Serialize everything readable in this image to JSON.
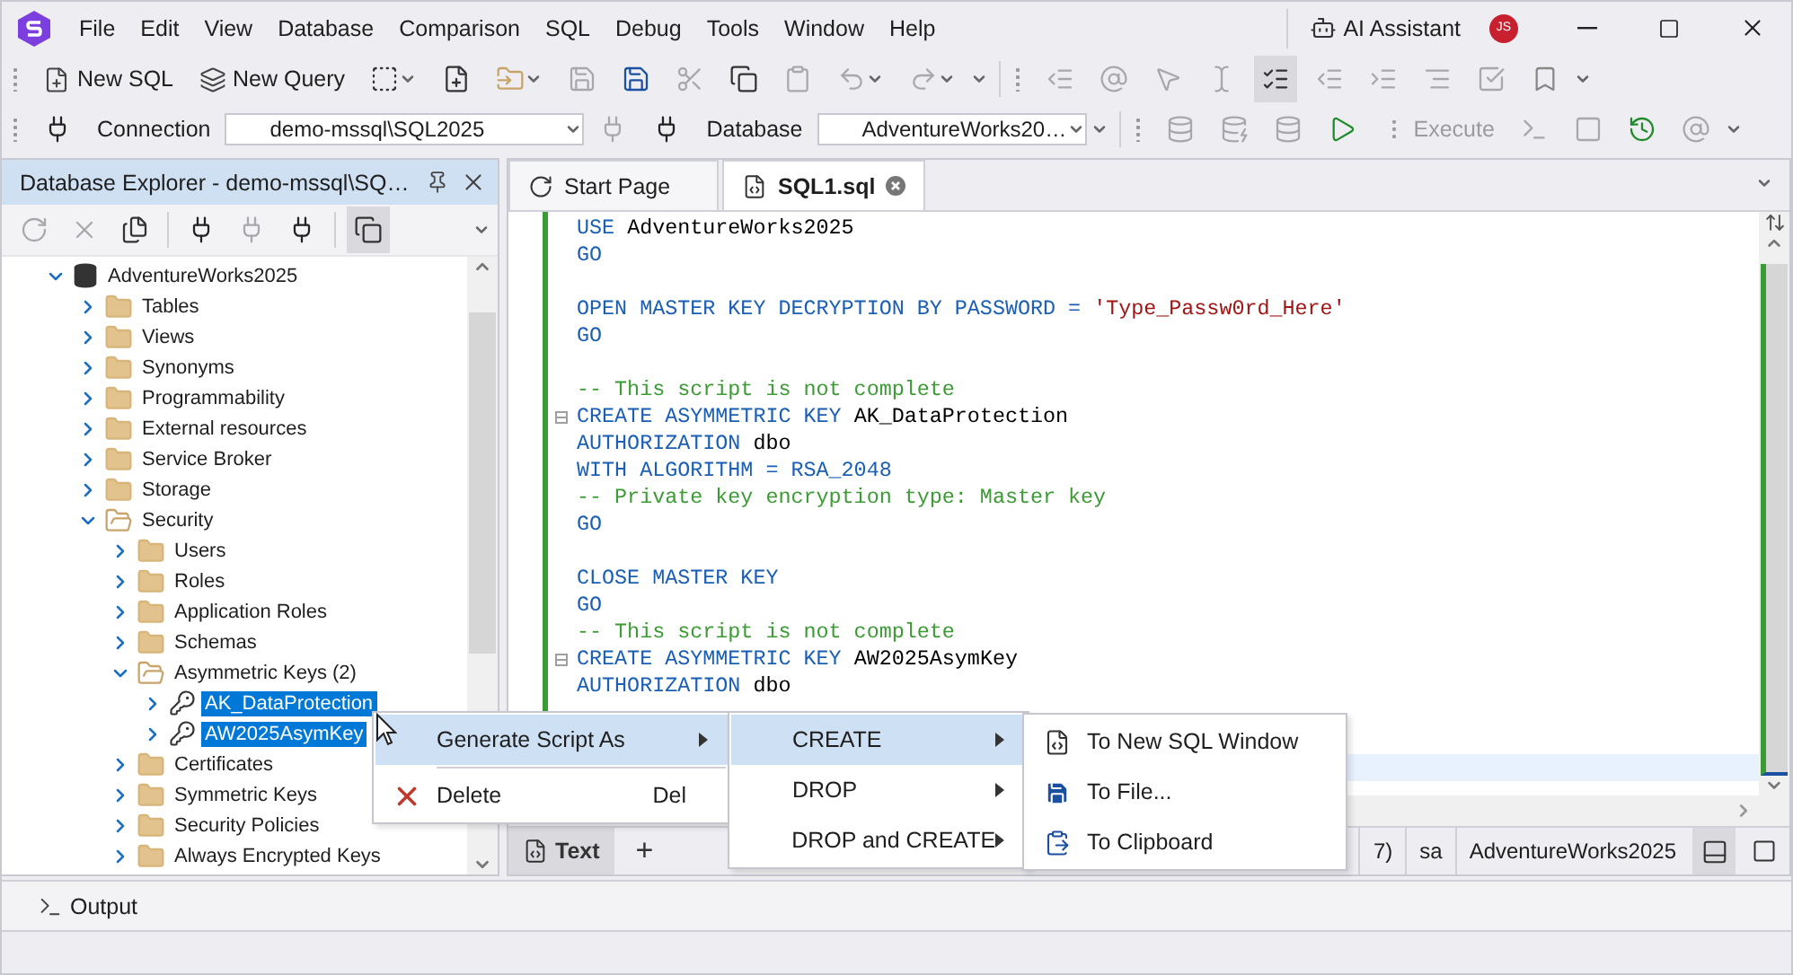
{
  "menu": [
    "File",
    "Edit",
    "View",
    "Database",
    "Comparison",
    "SQL",
    "Debug",
    "Tools",
    "Window",
    "Help"
  ],
  "ai_assistant": "AI Assistant",
  "avatar": "JS",
  "toolbar": {
    "new_sql": "New SQL",
    "new_query": "New Query"
  },
  "connection_bar": {
    "connection_label": "Connection",
    "connection": "demo-mssql\\SQL2025",
    "database_label": "Database",
    "database": "AdventureWorks20…",
    "execute": "Execute"
  },
  "explorer": {
    "title": "Database Explorer - demo-mssql\\SQ…",
    "tree": [
      {
        "label": "AdventureWorks2025",
        "kind": "database",
        "expanded": true,
        "selected": false,
        "children": [
          {
            "label": "Tables",
            "kind": "folder",
            "expanded": false,
            "selected": false
          },
          {
            "label": "Views",
            "kind": "folder",
            "expanded": false,
            "selected": false
          },
          {
            "label": "Synonyms",
            "kind": "folder",
            "expanded": false,
            "selected": false
          },
          {
            "label": "Programmability",
            "kind": "folder",
            "expanded": false,
            "selected": false
          },
          {
            "label": "External resources",
            "kind": "folder",
            "expanded": false,
            "selected": false
          },
          {
            "label": "Service Broker",
            "kind": "folder",
            "expanded": false,
            "selected": false
          },
          {
            "label": "Storage",
            "kind": "folder",
            "expanded": false,
            "selected": false
          },
          {
            "label": "Security",
            "kind": "folder",
            "expanded": true,
            "selected": false,
            "children": [
              {
                "label": "Users",
                "kind": "folder",
                "expanded": false,
                "selected": false
              },
              {
                "label": "Roles",
                "kind": "folder",
                "expanded": false,
                "selected": false
              },
              {
                "label": "Application Roles",
                "kind": "folder",
                "expanded": false,
                "selected": false
              },
              {
                "label": "Schemas",
                "kind": "folder",
                "expanded": false,
                "selected": false
              },
              {
                "label": "Asymmetric Keys (2)",
                "kind": "folder",
                "expanded": true,
                "selected": false,
                "children": [
                  {
                    "label": "AK_DataProtection",
                    "kind": "key",
                    "expanded": false,
                    "selected": true
                  },
                  {
                    "label": "AW2025AsymKey",
                    "kind": "key",
                    "expanded": false,
                    "selected": true
                  }
                ]
              },
              {
                "label": "Certificates",
                "kind": "folder",
                "expanded": false,
                "selected": false
              },
              {
                "label": "Symmetric Keys",
                "kind": "folder",
                "expanded": false,
                "selected": false
              },
              {
                "label": "Security Policies",
                "kind": "folder",
                "expanded": false,
                "selected": false
              },
              {
                "label": "Always Encrypted Keys",
                "kind": "folder",
                "expanded": false,
                "selected": false
              }
            ]
          }
        ]
      }
    ]
  },
  "editor": {
    "tabs": [
      {
        "label": "Start Page",
        "selected": false
      },
      {
        "label": "SQL1.sql",
        "selected": true
      }
    ],
    "lines": [
      {
        "kind": "code",
        "tokens": [
          {
            "kind": "kw",
            "text": "USE "
          },
          {
            "kind": "id",
            "text": "AdventureWorks2025"
          }
        ]
      },
      {
        "kind": "code",
        "tokens": [
          {
            "kind": "kw",
            "text": "GO"
          }
        ]
      },
      {
        "kind": "blank"
      },
      {
        "kind": "code",
        "tokens": [
          {
            "kind": "kw",
            "text": "OPEN MASTER KEY DECRYPTION BY PASSWORD = "
          },
          {
            "kind": "str",
            "text": "'Type_Passw0rd_Here'"
          }
        ]
      },
      {
        "kind": "code",
        "tokens": [
          {
            "kind": "kw",
            "text": "GO"
          }
        ]
      },
      {
        "kind": "blank"
      },
      {
        "kind": "code",
        "tokens": [
          {
            "kind": "comment",
            "text": "-- This script is not complete"
          }
        ]
      },
      {
        "kind": "code",
        "fold": true,
        "tokens": [
          {
            "kind": "kw",
            "text": "CREATE ASYMMETRIC KEY "
          },
          {
            "kind": "id",
            "text": "AK_DataProtection"
          }
        ]
      },
      {
        "kind": "code",
        "tokens": [
          {
            "kind": "kw",
            "text": "AUTHORIZATION "
          },
          {
            "kind": "id",
            "text": "dbo"
          }
        ]
      },
      {
        "kind": "code",
        "tokens": [
          {
            "kind": "kw",
            "text": "WITH ALGORITHM = RSA_2048"
          }
        ]
      },
      {
        "kind": "code",
        "tokens": [
          {
            "kind": "comment",
            "text": "-- Private key encryption type: Master key"
          }
        ]
      },
      {
        "kind": "code",
        "tokens": [
          {
            "kind": "kw",
            "text": "GO"
          }
        ]
      },
      {
        "kind": "blank"
      },
      {
        "kind": "code",
        "tokens": [
          {
            "kind": "kw",
            "text": "CLOSE MASTER KEY"
          }
        ]
      },
      {
        "kind": "code",
        "tokens": [
          {
            "kind": "kw",
            "text": "GO"
          }
        ]
      },
      {
        "kind": "code",
        "tokens": [
          {
            "kind": "comment",
            "text": "-- This script is not complete"
          }
        ]
      },
      {
        "kind": "code",
        "fold": true,
        "tokens": [
          {
            "kind": "kw",
            "text": "CREATE ASYMMETRIC KEY "
          },
          {
            "kind": "id",
            "text": "AW2025AsymKey"
          }
        ]
      },
      {
        "kind": "code",
        "tokens": [
          {
            "kind": "kw",
            "text": "AUTHORIZATION "
          },
          {
            "kind": "id",
            "text": "dbo"
          }
        ]
      },
      {
        "kind": "blank"
      },
      {
        "kind": "blank"
      },
      {
        "kind": "blank",
        "current": true
      }
    ]
  },
  "editor_footer": {
    "text_tab": "Text",
    "add": "+",
    "status": [
      "7)",
      "sa",
      "AdventureWorks2025"
    ]
  },
  "context_menus": [
    {
      "items": [
        {
          "kind": "plain",
          "label": "Generate Script As",
          "submenu": true,
          "selected": true
        },
        {
          "kind": "separator"
        },
        {
          "kind": "delete",
          "label": "Delete",
          "shortcut": "Del",
          "submenu": false,
          "selected": false
        }
      ]
    },
    {
      "items": [
        {
          "kind": "plain",
          "label": "CREATE",
          "submenu": true,
          "selected": true
        },
        {
          "kind": "plain",
          "label": "DROP",
          "submenu": true,
          "selected": false
        },
        {
          "kind": "plain",
          "label": "DROP and CREATE",
          "submenu": true,
          "selected": false
        }
      ]
    },
    {
      "items": [
        {
          "kind": "sql",
          "label": "To New SQL Window",
          "submenu": false,
          "selected": false
        },
        {
          "kind": "save",
          "label": "To File...",
          "submenu": false,
          "selected": false
        },
        {
          "kind": "clipboard",
          "label": "To Clipboard",
          "submenu": false,
          "selected": false
        }
      ]
    }
  ],
  "output": "Output"
}
